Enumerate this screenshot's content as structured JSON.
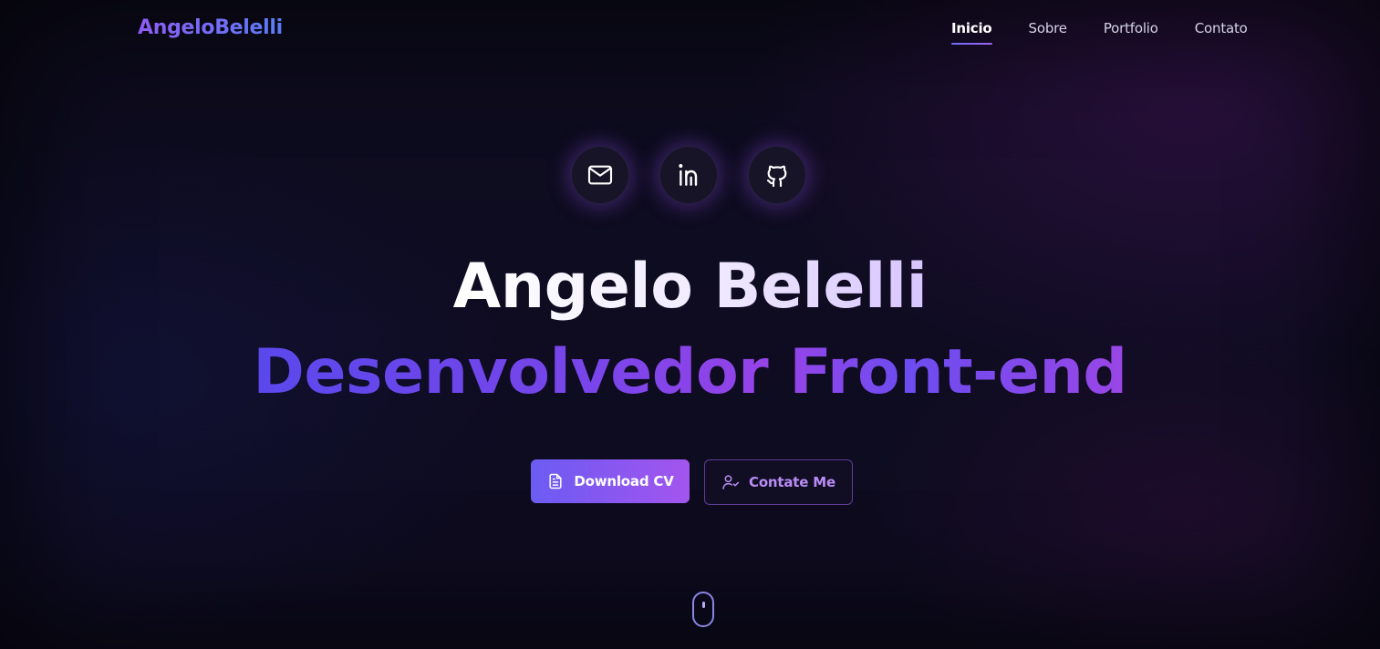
{
  "header": {
    "logo": "AngeloBelelli",
    "nav": [
      {
        "label": "Inicio",
        "active": true
      },
      {
        "label": "Sobre",
        "active": false
      },
      {
        "label": "Portfolio",
        "active": false
      },
      {
        "label": "Contato",
        "active": false
      }
    ]
  },
  "socials": [
    {
      "icon": "mail-icon"
    },
    {
      "icon": "linkedin-icon"
    },
    {
      "icon": "github-icon"
    }
  ],
  "hero": {
    "name": "Angelo Belelli",
    "role": "Desenvolvedor Front-end"
  },
  "actions": {
    "download_label": "Download CV",
    "download_icon": "document-icon",
    "contact_label": "Contate Me",
    "contact_icon": "user-check-icon"
  },
  "scroll_indicator": {
    "icon": "mouse-scroll-icon"
  },
  "colors": {
    "background": "#0b0a1a",
    "accent_start": "#6b5cf2",
    "accent_end": "#a356ee",
    "role_gradient": [
      "#5a48ec",
      "#9844e8"
    ],
    "outline_text": "#b98cf5"
  }
}
